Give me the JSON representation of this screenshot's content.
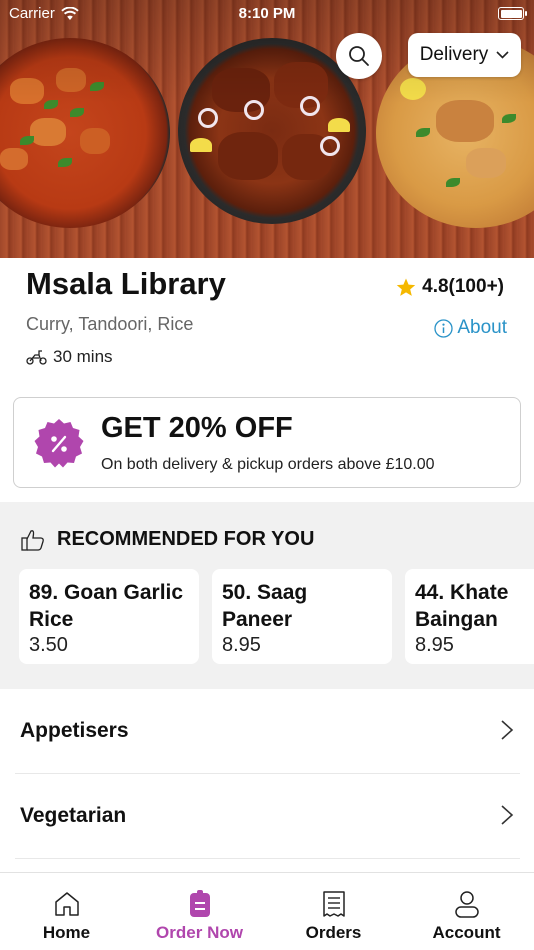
{
  "status_bar": {
    "carrier": "Carrier",
    "time": "8:10 PM",
    "battery_level": 1.0
  },
  "header": {
    "delivery_mode": "Delivery"
  },
  "restaurant": {
    "name": "Msala Library",
    "rating": "4.8(100+)",
    "cuisines": "Curry, Tandoori, Rice",
    "about_label": "About",
    "delivery_time": "30 mins"
  },
  "offer": {
    "title": "GET 20% OFF",
    "subtitle": "On both delivery & pickup orders above £10.00"
  },
  "recommended": {
    "heading": "RECOMMENDED FOR YOU",
    "items": [
      {
        "name": "89. Goan Garlic Rice",
        "price": "3.50"
      },
      {
        "name": "50. Saag Paneer",
        "price": "8.95"
      },
      {
        "name": "44. Khate Baingan",
        "price": "8.95"
      }
    ]
  },
  "categories": [
    {
      "label": "Appetisers"
    },
    {
      "label": "Vegetarian"
    }
  ],
  "tabs": [
    {
      "label": "Home",
      "icon": "home-icon",
      "active": false
    },
    {
      "label": "Order Now",
      "icon": "order-icon",
      "active": true
    },
    {
      "label": "Orders",
      "icon": "receipt-icon",
      "active": false
    },
    {
      "label": "Account",
      "icon": "user-icon",
      "active": false
    }
  ],
  "colors": {
    "accent": "#b046ad",
    "link": "#2a93c8",
    "star": "#f5b800"
  }
}
